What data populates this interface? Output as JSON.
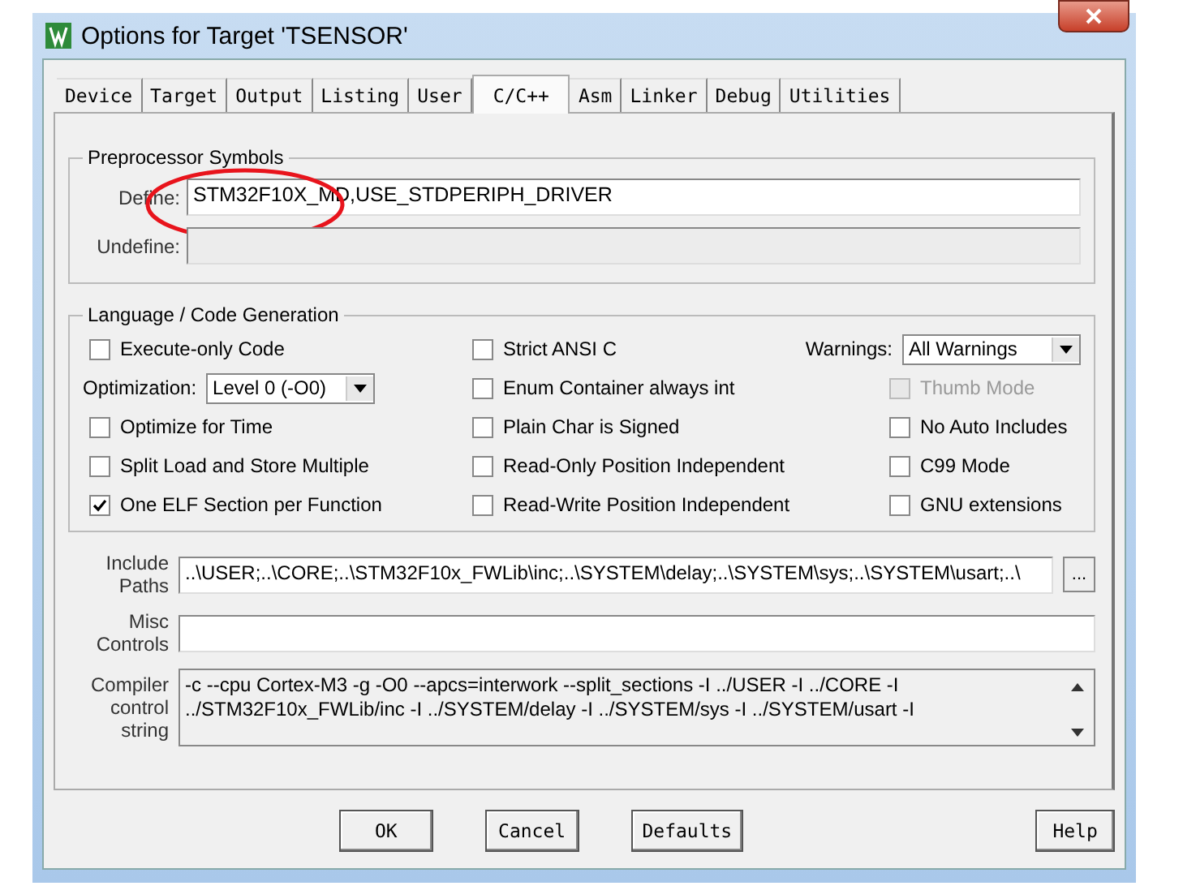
{
  "window": {
    "title": "Options for Target 'TSENSOR'"
  },
  "tabs": [
    {
      "label": "Device",
      "selected": false
    },
    {
      "label": "Target",
      "selected": false
    },
    {
      "label": "Output",
      "selected": false
    },
    {
      "label": "Listing",
      "selected": false
    },
    {
      "label": "User",
      "selected": false
    },
    {
      "label": "C/C++",
      "selected": true
    },
    {
      "label": "Asm",
      "selected": false
    },
    {
      "label": "Linker",
      "selected": false
    },
    {
      "label": "Debug",
      "selected": false
    },
    {
      "label": "Utilities",
      "selected": false
    }
  ],
  "preprocessor": {
    "title": "Preprocessor Symbols",
    "define": {
      "label": "Define:",
      "value": "STM32F10X_MD,USE_STDPERIPH_DRIVER"
    },
    "undefine": {
      "label": "Undefine:",
      "disabled": true
    }
  },
  "language": {
    "title": "Language / Code Generation",
    "columns": [
      [
        {
          "kind": "checkbox",
          "label": "Execute-only Code",
          "checked": false,
          "disabled": false
        },
        {
          "kind": "select",
          "label": "Optimization:",
          "value": "Level 0 (-O0)"
        },
        {
          "kind": "checkbox",
          "label": "Optimize for Time",
          "checked": false,
          "disabled": false
        },
        {
          "kind": "checkbox",
          "label": "Split Load and Store Multiple",
          "checked": false,
          "disabled": false
        },
        {
          "kind": "checkbox",
          "label": "One ELF Section per Function",
          "checked": true,
          "disabled": false
        }
      ],
      [
        {
          "kind": "checkbox",
          "label": "Strict ANSI C",
          "checked": false,
          "disabled": false
        },
        {
          "kind": "checkbox",
          "label": "Enum Container always int",
          "checked": false,
          "disabled": false
        },
        {
          "kind": "checkbox",
          "label": "Plain Char is Signed",
          "checked": false,
          "disabled": false
        },
        {
          "kind": "checkbox",
          "label": "Read-Only Position Independent",
          "checked": false,
          "disabled": false
        },
        {
          "kind": "checkbox",
          "label": "Read-Write Position Independent",
          "checked": false,
          "disabled": false
        }
      ],
      [
        {
          "kind": "select",
          "label": "Warnings:",
          "value": "All Warnings"
        },
        {
          "kind": "checkbox",
          "label": "Thumb Mode",
          "checked": false,
          "disabled": true
        },
        {
          "kind": "checkbox",
          "label": "No Auto Includes",
          "checked": false,
          "disabled": false
        },
        {
          "kind": "checkbox",
          "label": "C99 Mode",
          "checked": false,
          "disabled": false
        },
        {
          "kind": "checkbox",
          "label": "GNU extensions",
          "checked": false,
          "disabled": false
        }
      ]
    ]
  },
  "include_paths": {
    "label": "Include Paths",
    "value": "..\\USER;..\\CORE;..\\STM32F10x_FWLib\\inc;..\\SYSTEM\\delay;..\\SYSTEM\\sys;..\\SYSTEM\\usart;..\\",
    "browse": "..."
  },
  "misc_controls": {
    "label": "Misc Controls"
  },
  "compiler_control": {
    "label": "Compiler control string",
    "value": "-c --cpu Cortex-M3 -g -O0 --apcs=interwork --split_sections -I ../USER -I ../CORE -I ../STM32F10x_FWLib/inc -I ../SYSTEM/delay -I ../SYSTEM/sys -I ../SYSTEM/usart -I"
  },
  "buttons": [
    "OK",
    "Cancel",
    "Defaults",
    "Help"
  ]
}
